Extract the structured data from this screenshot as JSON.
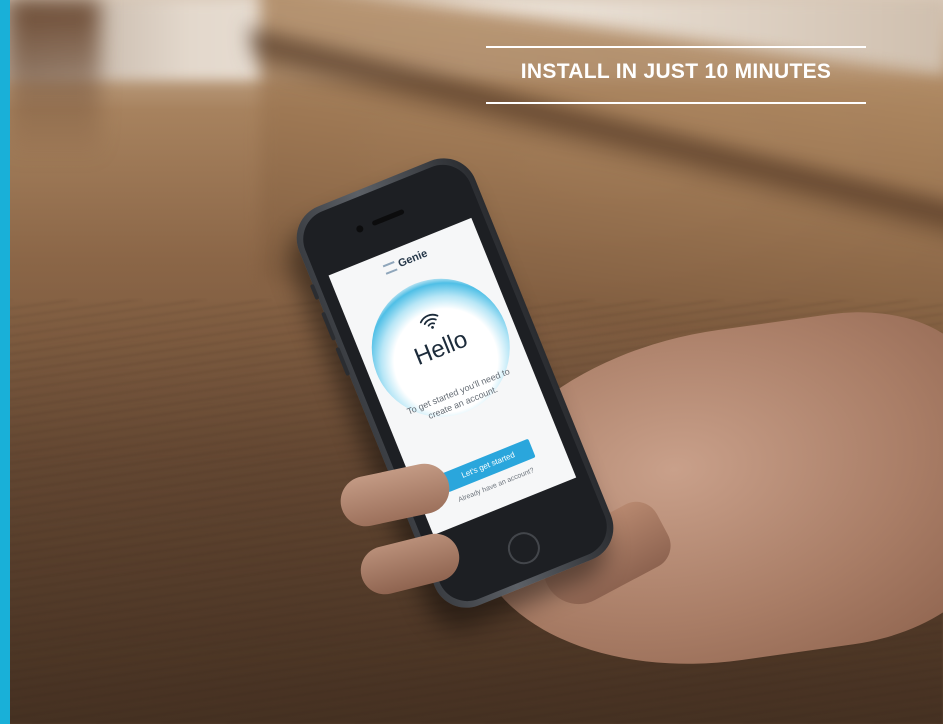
{
  "headline": "INSTALL IN JUST 10 MINUTES",
  "colors": {
    "accent": "#19b0d8",
    "cta": "#2aa6dc",
    "headline_text": "#ffffff"
  },
  "phone_app": {
    "brand": "Genie",
    "brand_icon": "genie-logo-icon",
    "status_icon": "wifi-icon",
    "greeting": "Hello",
    "intro_text": "To get started you'll need to create an account.",
    "primary_button": "Let's get started",
    "secondary_link": "Already have an account?"
  }
}
